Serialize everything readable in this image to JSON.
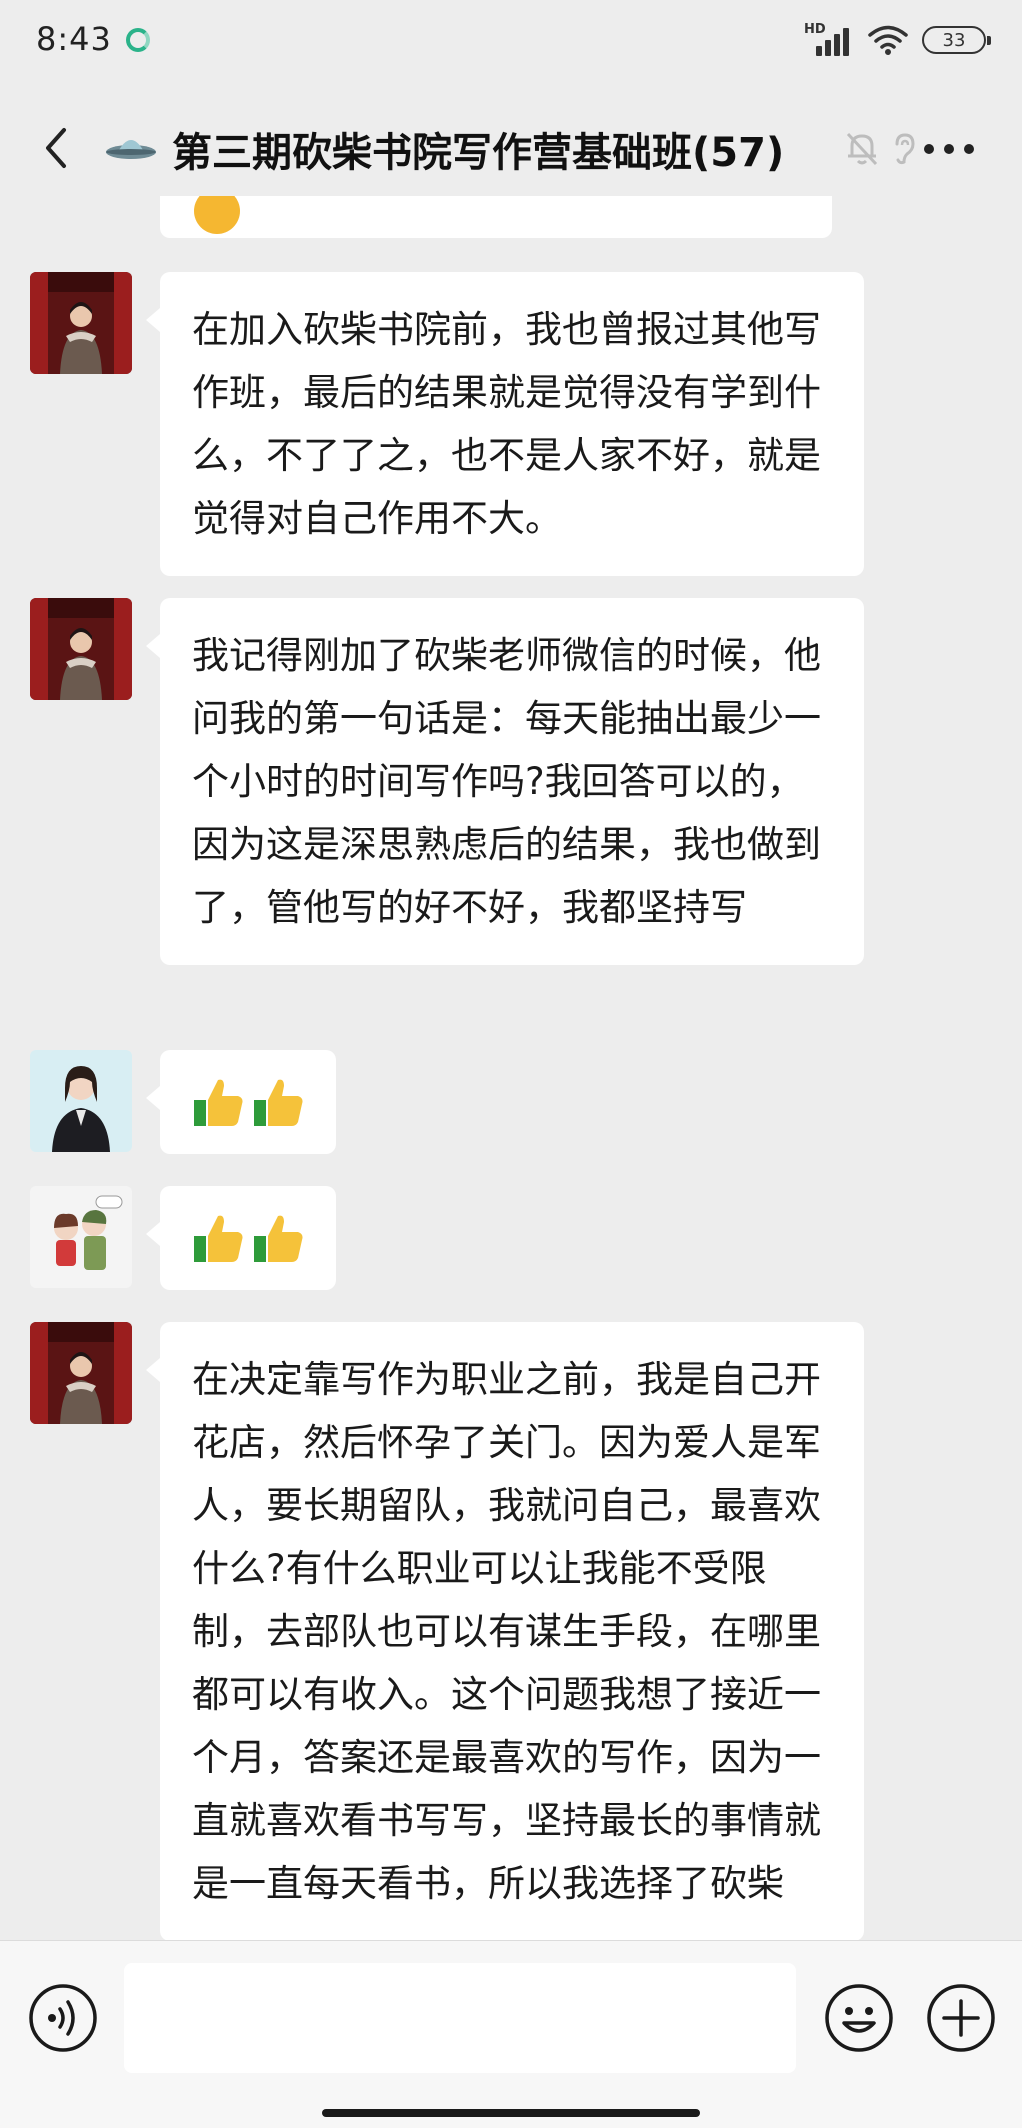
{
  "status_bar": {
    "time": "8:43",
    "network_badge": "HD",
    "battery_level": "33"
  },
  "header": {
    "title": "第三期砍柴书院写作营基础班(57)",
    "icons": [
      "back-icon",
      "ufo-icon",
      "mute-bell-icon",
      "ear-icon",
      "more-icon"
    ]
  },
  "messages": [
    {
      "type": "text",
      "sender": "member-red-gate",
      "text": "在加入砍柴书院前，我也曾报过其他写作班，最后的结果就是觉得没有学到什么，不了了之，也不是人家不好，就是觉得对自己作用不大。"
    },
    {
      "type": "text",
      "sender": "member-red-gate",
      "text": "我记得刚加了砍柴老师微信的时候，他问我的第一句话是：每天能抽出最少一个小时的时间写作吗?我回答可以的，因为这是深思熟虑后的结果，我也做到了，管他写的好不好，我都坚持写"
    },
    {
      "type": "emoji",
      "sender": "member-portrait",
      "emoji": "thumbs-up-icon",
      "count": 2
    },
    {
      "type": "emoji",
      "sender": "member-cartoon",
      "emoji": "thumbs-up-icon",
      "count": 2
    },
    {
      "type": "text",
      "sender": "member-red-gate",
      "text": "在决定靠写作为职业之前，我是自己开花店，然后怀孕了关门。因为爱人是军人，要长期留队，我就问自己，最喜欢什么?有什么职业可以让我能不受限制，去部队也可以有谋生手段，在哪里都可以有收入。这个问题我想了接近一个月，答案还是最喜欢的写作，因为一直就喜欢看书写写，坚持最长的事情就是一直每天看书，所以我选择了砍柴"
    }
  ],
  "input_bar": {
    "message_value": "",
    "icons": [
      "voice-icon",
      "emoji-face-icon",
      "plus-icon"
    ]
  },
  "colors": {
    "background": "#ededed",
    "bubble": "#ffffff",
    "text": "#1a1a1a",
    "input_bar": "#f7f7f7"
  }
}
